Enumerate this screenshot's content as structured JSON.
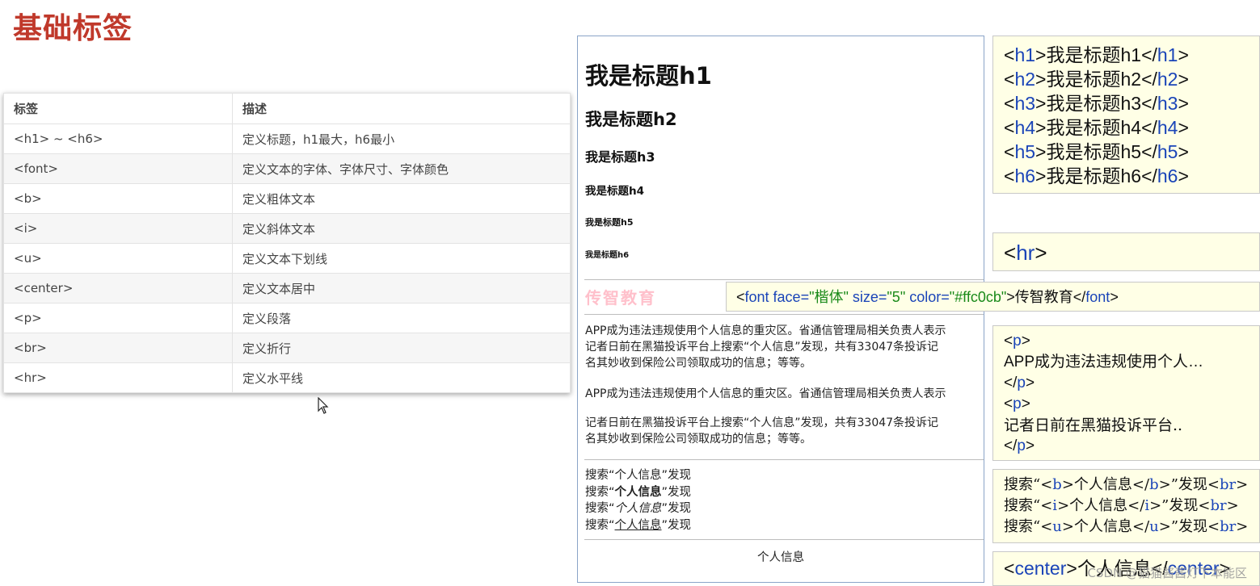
{
  "page_title": "基础标签",
  "table": {
    "headers": [
      "标签",
      "描述"
    ],
    "rows": [
      {
        "tag": "<h1> ~ <h6>",
        "desc": "定义标题，h1最大，h6最小"
      },
      {
        "tag": "<font>",
        "desc": "定义文本的字体、字体尺寸、字体颜色"
      },
      {
        "tag": "<b>",
        "desc": "定义粗体文本"
      },
      {
        "tag": "<i>",
        "desc": "定义斜体文本"
      },
      {
        "tag": "<u>",
        "desc": "定义文本下划线"
      },
      {
        "tag": "<center>",
        "desc": "定义文本居中"
      },
      {
        "tag": "<p>",
        "desc": "定义段落"
      },
      {
        "tag": "<br>",
        "desc": "定义折行"
      },
      {
        "tag": "<hr>",
        "desc": "定义水平线"
      }
    ]
  },
  "demo": {
    "headings": [
      "我是标题h1",
      "我是标题h2",
      "我是标题h3",
      "我是标题h4",
      "我是标题h5",
      "我是标题h6"
    ],
    "font_text": "传智教育",
    "font_color": "#ffc0cb",
    "para1": "APP成为违法违规使用个人信息的重灾区。省通信管理局相关负责人表示\n记者日前在黑猫投诉平台上搜索“个人信息”发现，共有33047条投诉记\n名其妙收到保险公司领取成功的信息；等等。",
    "para2": "APP成为违法违规使用个人信息的重灾区。省通信管理局相关负责人表示",
    "para3": "记者日前在黑猫投诉平台上搜索“个人信息”发现，共有33047条投诉记\n名其妙收到保险公司领取成功的信息；等等。",
    "search_prefix": "搜索“",
    "search_keyword": "个人信息",
    "search_suffix": "”发现",
    "center_text": "个人信息"
  },
  "code": {
    "headings": [
      {
        "tag": "h1",
        "text": "我是标题h1"
      },
      {
        "tag": "h2",
        "text": "我是标题h2"
      },
      {
        "tag": "h3",
        "text": "我是标题h3"
      },
      {
        "tag": "h4",
        "text": "我是标题h4"
      },
      {
        "tag": "h5",
        "text": "我是标题h5"
      },
      {
        "tag": "h6",
        "text": "我是标题h6"
      }
    ],
    "hr": "hr",
    "font": {
      "face": "楷体",
      "size": "5",
      "color": "#ffc0cb",
      "text": "传智教育"
    },
    "p1_text": "APP成为违法违规使用个人…",
    "p2_text": "记者日前在黑猫投诉平台..",
    "search_lines": [
      {
        "tag": "b",
        "text": "个人信息"
      },
      {
        "tag": "i",
        "text": "个人信息"
      },
      {
        "tag": "u",
        "text": "个人信息"
      }
    ],
    "center_text": "个人信息"
  },
  "watermark": "CSDN @猫猫酱酱灯下本能区"
}
